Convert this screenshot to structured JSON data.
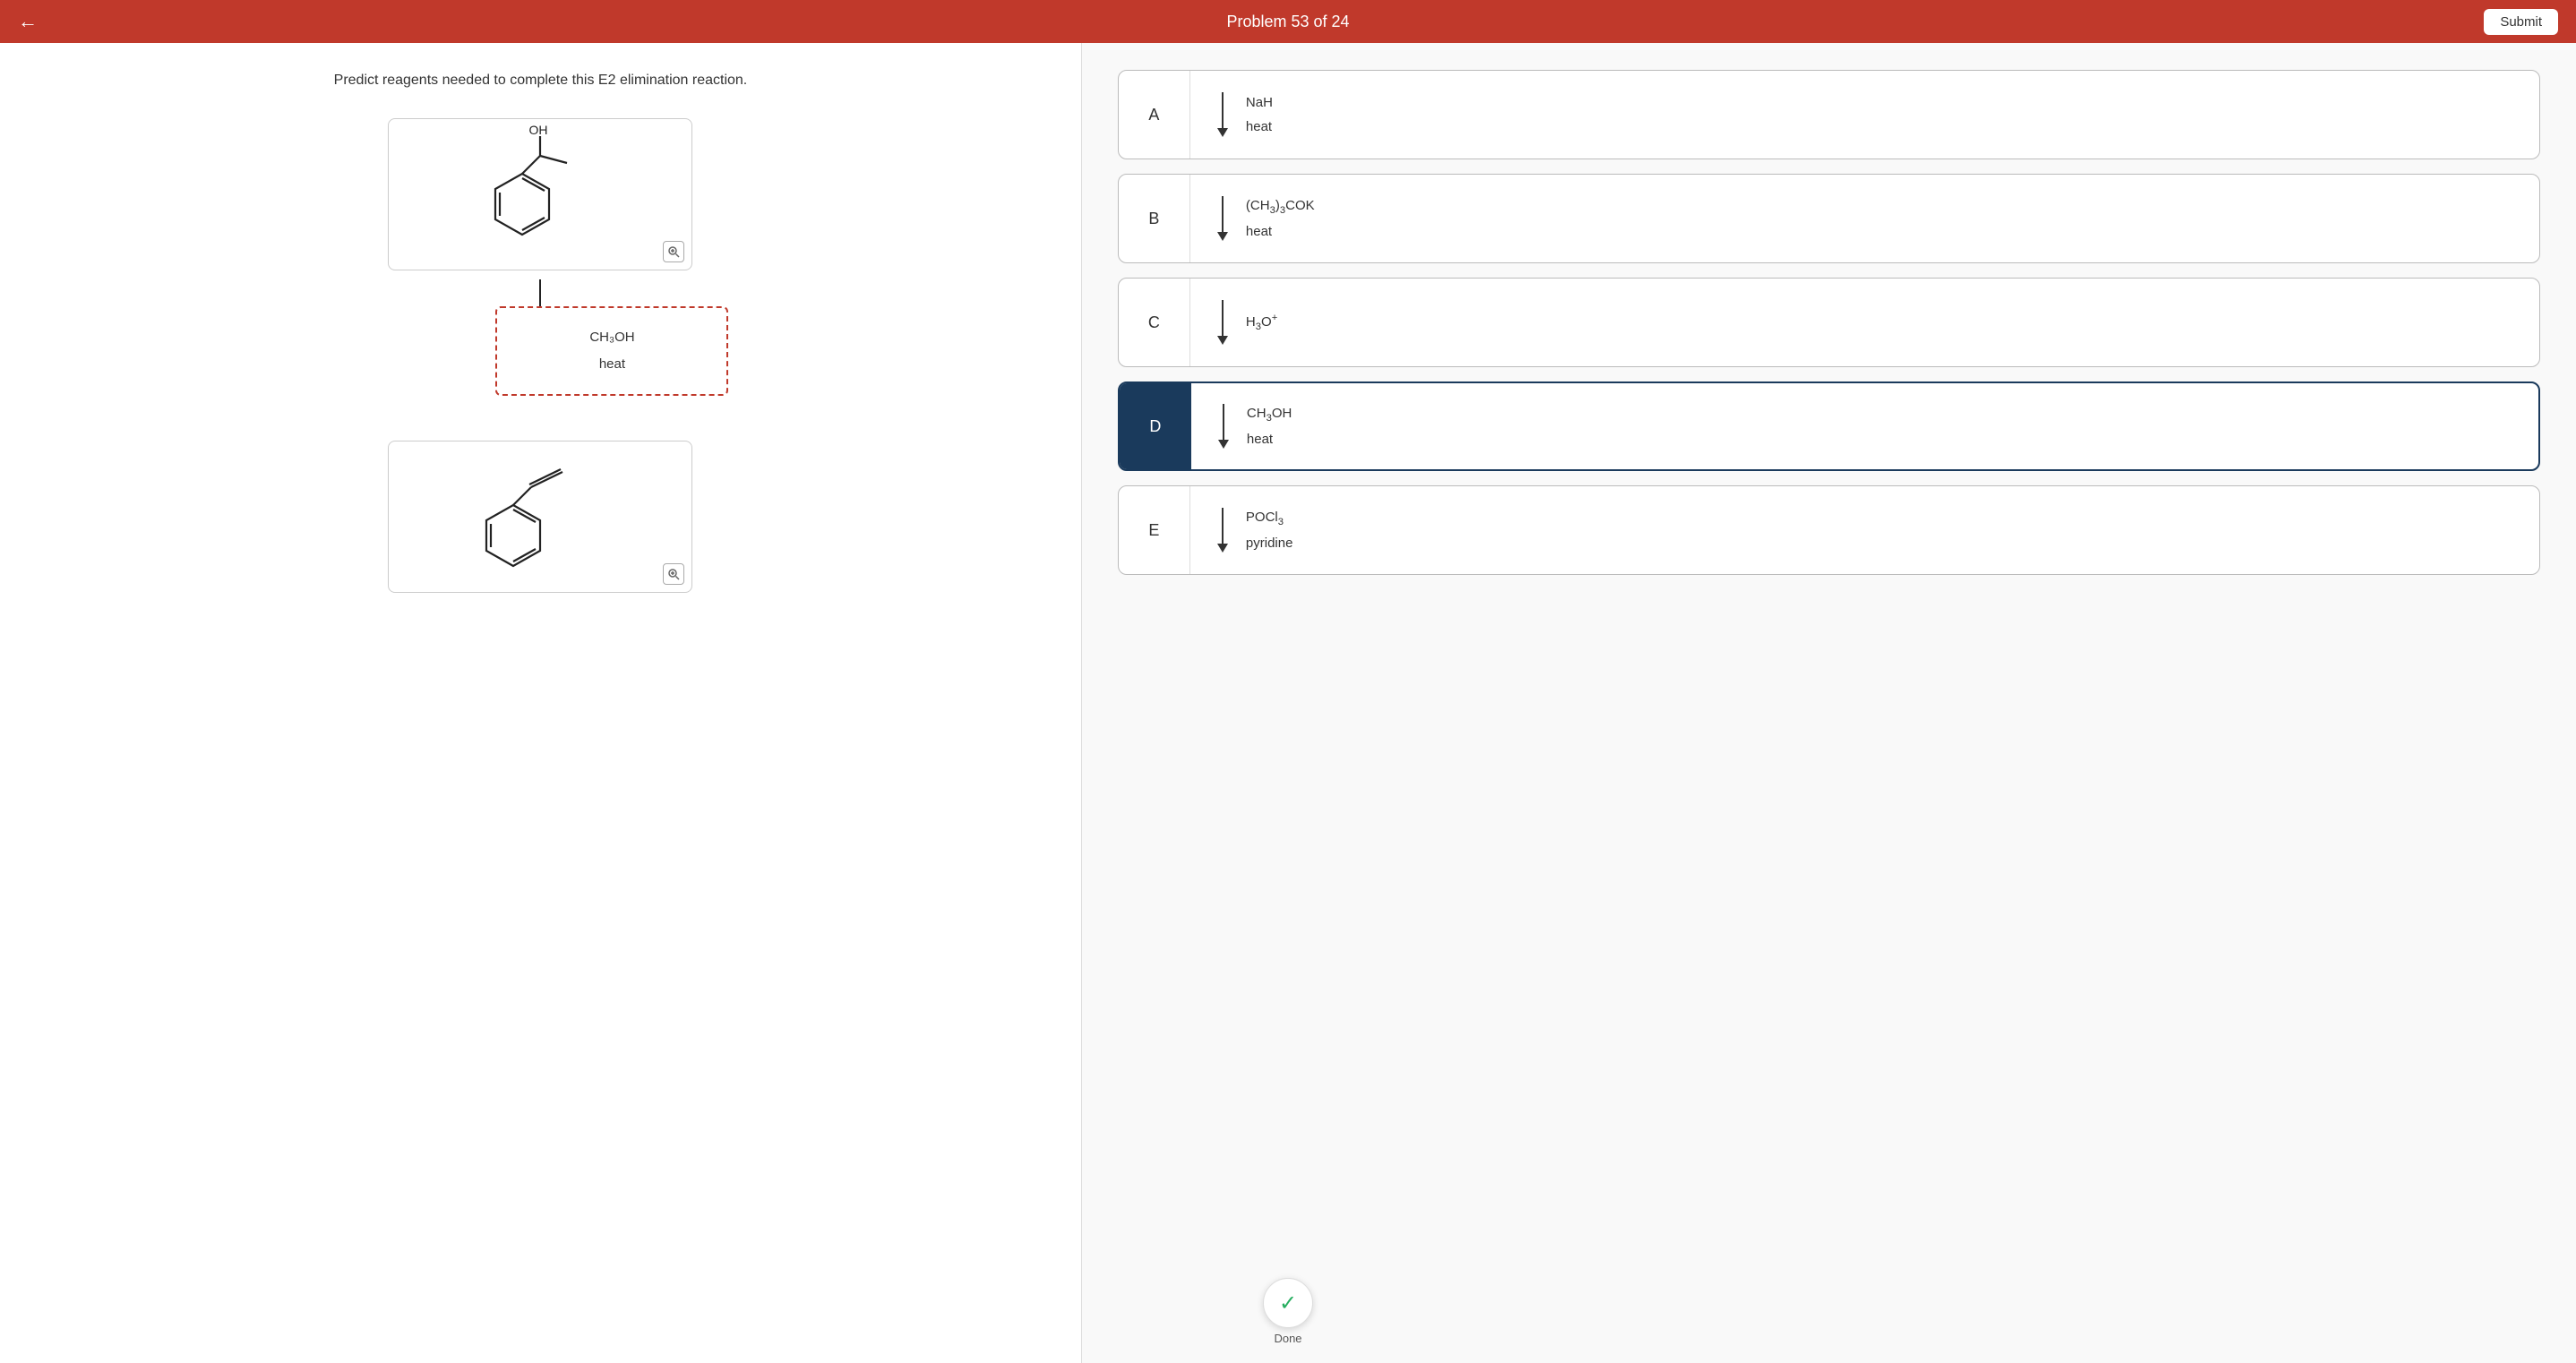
{
  "header": {
    "title": "Problem 53 of 24",
    "back_label": "←",
    "submit_label": "Submit"
  },
  "left": {
    "question": "Predict reagents needed to complete this E2 elimination reaction.",
    "reagent_line1": "CH₃OH",
    "reagent_line2": "heat",
    "zoom_icon": "🔍"
  },
  "options": [
    {
      "id": "A",
      "line1": "NaH",
      "line2": "heat",
      "selected": false
    },
    {
      "id": "B",
      "line1": "(CH₃)₃COK",
      "line2": "heat",
      "selected": false
    },
    {
      "id": "C",
      "line1": "H₃O⁺",
      "line2": "",
      "selected": false
    },
    {
      "id": "D",
      "line1": "CH₃OH",
      "line2": "heat",
      "selected": true
    },
    {
      "id": "E",
      "line1": "POCl₃",
      "line2": "pyridine",
      "selected": false
    }
  ],
  "done_label": "Done",
  "colors": {
    "header_bg": "#c0392b",
    "selected_bg": "#1a3a5c",
    "dashed_red": "#c0392b"
  }
}
